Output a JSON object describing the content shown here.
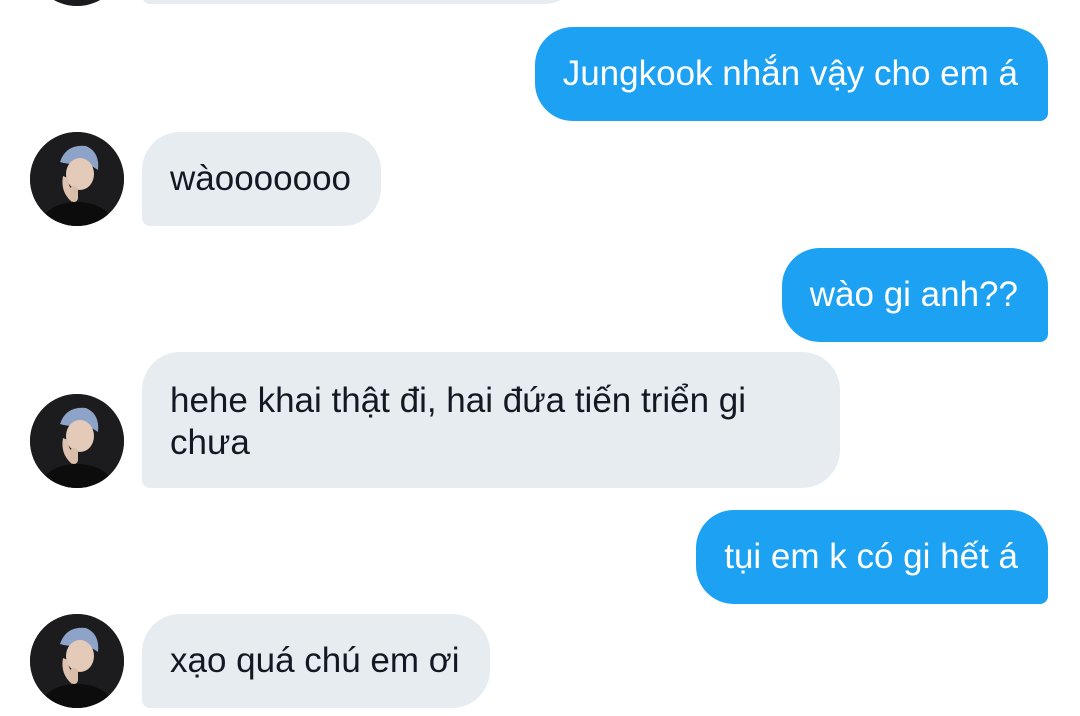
{
  "conversation": {
    "messages": [
      {
        "direction": "in",
        "text": ""
      },
      {
        "direction": "out",
        "text": "Jungkook nhắn vậy cho em á"
      },
      {
        "direction": "in",
        "text": "wàooooooo"
      },
      {
        "direction": "out",
        "text": "wào gi anh??"
      },
      {
        "direction": "in",
        "text": "hehe khai thật đi, hai đứa tiến triển gi chưa"
      },
      {
        "direction": "out",
        "text": "tụi em k có gi hết á"
      },
      {
        "direction": "in",
        "text": "xạo quá chú em ơi"
      }
    ]
  },
  "colors": {
    "outgoing_bubble": "#1da1f2",
    "incoming_bubble": "#e6ecf0",
    "outgoing_text": "#ffffff",
    "incoming_text": "#141823",
    "background": "#ffffff"
  },
  "icons": {
    "avatar": "contact-avatar-photo"
  }
}
